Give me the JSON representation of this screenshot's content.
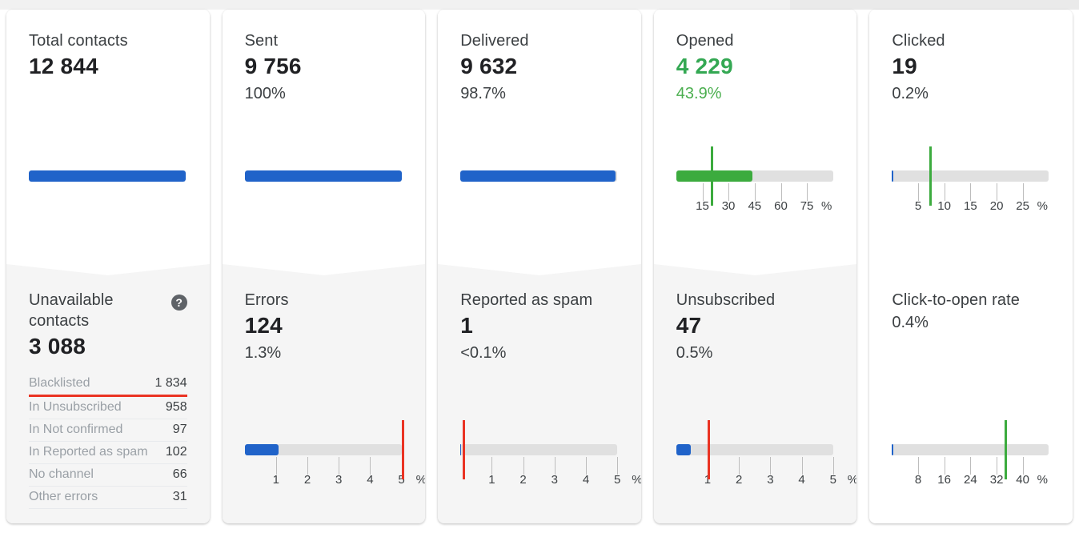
{
  "theme": {
    "blue": "#2063c9",
    "green": "#3cab3e",
    "red": "#ea3323",
    "track_gray": "#e0e0e0",
    "card_bg": "#ffffff",
    "panel_bg": "#f5f5f5"
  },
  "chart_data": {
    "type": "bar",
    "title": "Email campaign funnel statistics",
    "legend_position": "none",
    "grid": false,
    "categories": [
      "Total contacts",
      "Sent",
      "Delivered",
      "Opened",
      "Clicked"
    ],
    "values": [
      12844,
      9756,
      9632,
      4229,
      19
    ],
    "percentages": [
      null,
      100,
      98.7,
      43.9,
      0.2
    ],
    "secondary_categories": [
      "Unavailable contacts",
      "Errors",
      "Reported as spam",
      "Unsubscribed",
      "Click-to-open rate"
    ],
    "secondary_values": [
      3088,
      124,
      1,
      47,
      null
    ],
    "secondary_percentages": [
      null,
      1.3,
      0.1,
      0.5,
      0.4
    ],
    "xlabel": "",
    "ylabel": "%"
  },
  "cards": [
    {
      "top": {
        "label": "Total contacts",
        "value": "12 844",
        "percent": "",
        "bar": {
          "kind": "simple",
          "fill_pct": 100,
          "color": "blue"
        }
      },
      "bottom": {
        "label": "Unavailable contacts",
        "value": "3 088",
        "percent": "",
        "has_help": true,
        "help_glyph": "?",
        "breakdown": [
          {
            "name": "Blacklisted",
            "value": "1 834",
            "highlight": true
          },
          {
            "name": "In Unsubscribed",
            "value": "958",
            "highlight": false
          },
          {
            "name": "In Not confirmed",
            "value": "97",
            "highlight": false
          },
          {
            "name": "In Reported as spam",
            "value": "102",
            "highlight": false
          },
          {
            "name": "No channel",
            "value": "66",
            "highlight": false
          },
          {
            "name": "Other errors",
            "value": "31",
            "highlight": false
          }
        ]
      }
    },
    {
      "top": {
        "label": "Sent",
        "value": "9 756",
        "percent": "100%",
        "bar": {
          "kind": "simple",
          "fill_pct": 100,
          "color": "blue"
        }
      },
      "bottom": {
        "label": "Errors",
        "value": "124",
        "percent": "1.3%",
        "gauge": {
          "fill_pct": 21.5,
          "fill_color": "blue",
          "threshold_pct": 100,
          "threshold_color": "red",
          "ticks": [
            "1",
            "2",
            "3",
            "4",
            "5"
          ],
          "tick_positions": [
            20,
            40,
            60,
            80,
            100
          ],
          "unit": "%"
        }
      }
    },
    {
      "top": {
        "label": "Delivered",
        "value": "9 632",
        "percent": "98.7%",
        "bar": {
          "kind": "simple",
          "fill_pct": 98.7,
          "color": "blue"
        }
      },
      "bottom": {
        "label": "Reported as spam",
        "value": "1",
        "percent": "<0.1%",
        "gauge": {
          "fill_pct": 0.6,
          "fill_color": "blue",
          "threshold_pct": 1.2,
          "threshold_color": "red",
          "ticks": [
            "1",
            "2",
            "3",
            "4",
            "5"
          ],
          "tick_positions": [
            20,
            40,
            60,
            80,
            100
          ],
          "unit": "%"
        }
      }
    },
    {
      "top": {
        "label": "Opened",
        "value": "4 229",
        "percent": "43.9%",
        "value_color": "green",
        "gauge": {
          "fill_pct": 48.8,
          "fill_color": "green",
          "threshold_pct": 22,
          "threshold_color": "green",
          "ticks": [
            "15",
            "30",
            "45",
            "60",
            "75"
          ],
          "tick_positions": [
            16.7,
            33.3,
            50,
            66.7,
            83.3
          ],
          "unit": "%"
        }
      },
      "bottom": {
        "label": "Unsubscribed",
        "value": "47",
        "percent": "0.5%",
        "gauge": {
          "fill_pct": 9.5,
          "fill_color": "blue",
          "threshold_pct": 20,
          "threshold_color": "red",
          "ticks": [
            "1",
            "2",
            "3",
            "4",
            "5"
          ],
          "tick_positions": [
            20,
            40,
            60,
            80,
            100
          ],
          "unit": "%"
        }
      }
    },
    {
      "top": {
        "label": "Clicked",
        "value": "19",
        "percent": "0.2%",
        "gauge": {
          "fill_pct": 0.8,
          "fill_color": "blue",
          "threshold_pct": 24,
          "threshold_color": "green",
          "ticks": [
            "5",
            "10",
            "15",
            "20",
            "25"
          ],
          "tick_positions": [
            16.7,
            33.3,
            50,
            66.7,
            83.3
          ],
          "unit": "%"
        }
      },
      "bottom": {
        "label": "Click-to-open rate",
        "value": "",
        "percent": "0.4%",
        "plain_bg": true,
        "gauge": {
          "fill_pct": 0.8,
          "fill_color": "blue",
          "threshold_pct": 72,
          "threshold_color": "green",
          "ticks": [
            "8",
            "16",
            "24",
            "32",
            "40"
          ],
          "tick_positions": [
            16.7,
            33.3,
            50,
            66.7,
            83.3
          ],
          "unit": "%"
        }
      }
    }
  ]
}
